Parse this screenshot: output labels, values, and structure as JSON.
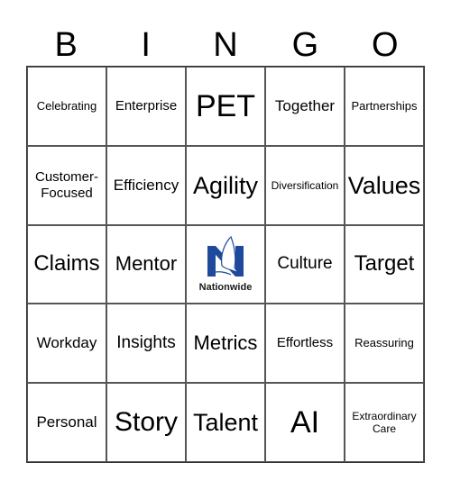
{
  "header": {
    "letters": [
      "B",
      "I",
      "N",
      "G",
      "O"
    ]
  },
  "logo": {
    "name": "Nationwide",
    "color": "#1f4a9c"
  },
  "cells": [
    "Celebrating",
    "Enterprise",
    "PET",
    "Together",
    "Partnerships",
    "Customer-Focused",
    "Efficiency",
    "Agility",
    "Diversification",
    "Values",
    "Claims",
    "Mentor",
    "",
    "Culture",
    "Target",
    "Workday",
    "Insights",
    "Metrics",
    "Effortless",
    "Reassuring",
    "Personal",
    "Story",
    "Talent",
    "AI",
    "Extraordinary Care"
  ]
}
